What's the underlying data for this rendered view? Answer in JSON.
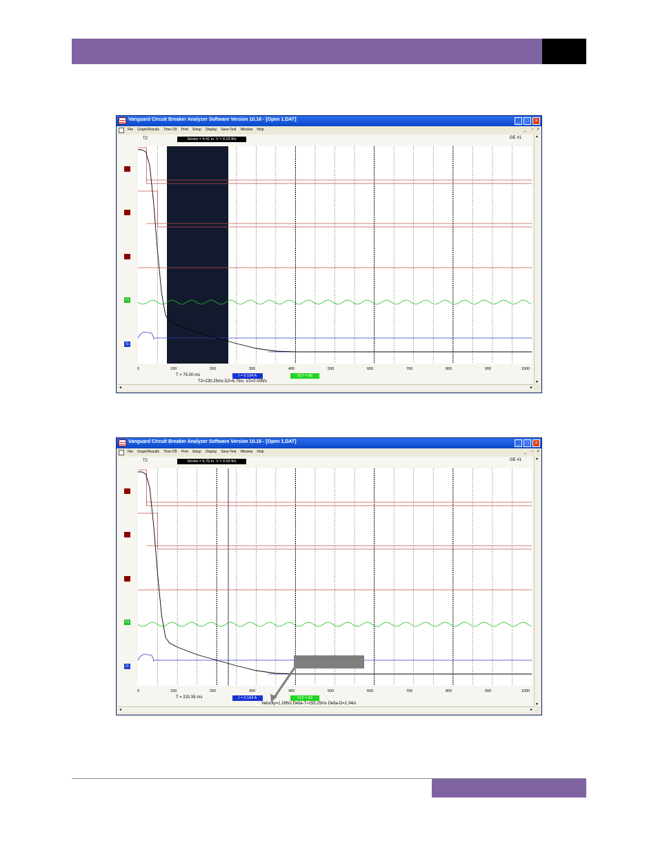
{
  "windows": [
    {
      "title": "Vanguard Circuit Breaker Analyzer Software Version 10.16 - [Open 1.DAT]",
      "menu": [
        "File",
        "Graph/Results",
        "Time-CB",
        "Print",
        "Setup",
        "Display",
        "Save-Test",
        "Window",
        "Help"
      ],
      "t2_label": "T2",
      "stroke_label": "Stroke = 4.41 in. V = 8.33 ft/s",
      "ge_label": "GE #1",
      "ticks": [
        "0",
        "100",
        "200",
        "300",
        "400",
        "500",
        "600",
        "700",
        "800",
        "900",
        "1000"
      ],
      "t_readout": "T = 75.00 ms",
      "i_readout": "I = 0.164 A",
      "vlt_readout": "VLT = 58",
      "status_text": "T2=230.25ms D2=6.75in. V2=0.00ft/s",
      "channels": [
        "",
        "",
        "",
        "V1",
        "I1"
      ]
    },
    {
      "title": "Vanguard Circuit Breaker Analyzer Software Version 10.16 - [Open 1.DAT]",
      "menu": [
        "File",
        "Graph/Results",
        "Time-CB",
        "Print",
        "Setup",
        "Display",
        "Save-Test",
        "Window",
        "Help"
      ],
      "t2_label": "T2",
      "stroke_label": "Stroke = 6.75 in. V = 0.00 ft/s",
      "ge_label": "GE #1",
      "ticks": [
        "0",
        "100",
        "200",
        "300",
        "400",
        "500",
        "600",
        "700",
        "800",
        "900",
        "1000"
      ],
      "t_readout": "T = 231.55 ms",
      "i_readout": "I = 0.164 A",
      "vlt_readout": "VLT = 62",
      "status_text": "Velocity=1.26ft/s Delta-T=155.25ms Delta-D=2.34in.",
      "channels": [
        "",
        "",
        "",
        "V1",
        "I1"
      ]
    }
  ],
  "colors": {
    "header_band": "#8064a2",
    "contact_trace": "#c0504d",
    "marker_red": "#8b0000",
    "velocity_trace": "#22c022",
    "current_trace": "#3040c0",
    "motion_trace": "#000000",
    "shade_region": "#141a2e"
  }
}
